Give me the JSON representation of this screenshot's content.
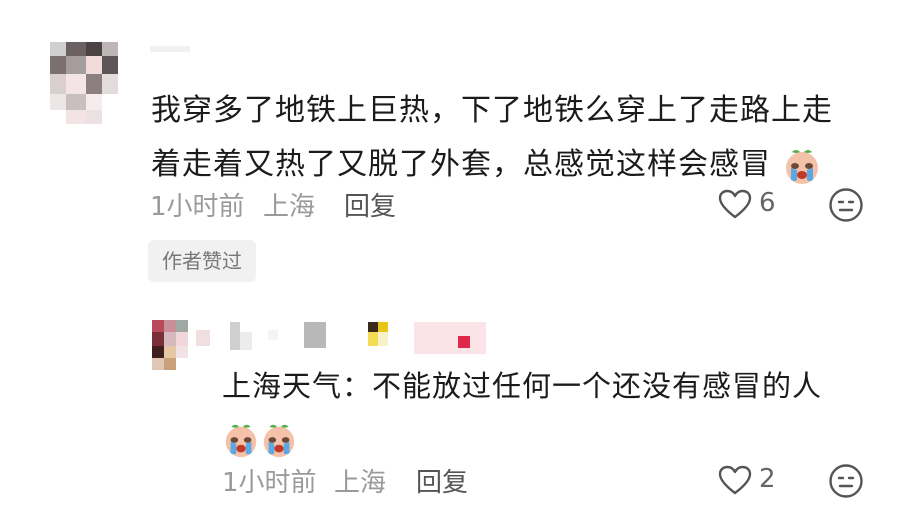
{
  "comment": {
    "text": "我穿多了地铁上巨热，下了地铁么穿上了走路上走着走着又热了又脱了外套，总感觉这样会感冒",
    "time": "1小时前",
    "location": "上海",
    "reply_label": "回复",
    "like_count": "6",
    "badge": "作者赞过"
  },
  "reply": {
    "text": "上海天气：不能放过任何一个还没有感冒的人",
    "time": "1小时前",
    "location": "上海",
    "reply_label": "回复",
    "like_count": "2"
  },
  "colors": {
    "meta": "#9a9a9a",
    "badge_bg": "#f1f1f1",
    "emoji_green": "#55b04a",
    "emoji_face": "#f4c2a8"
  },
  "icons": [
    "heart-icon",
    "dislike-face-icon",
    "crying-sticker-icon"
  ]
}
